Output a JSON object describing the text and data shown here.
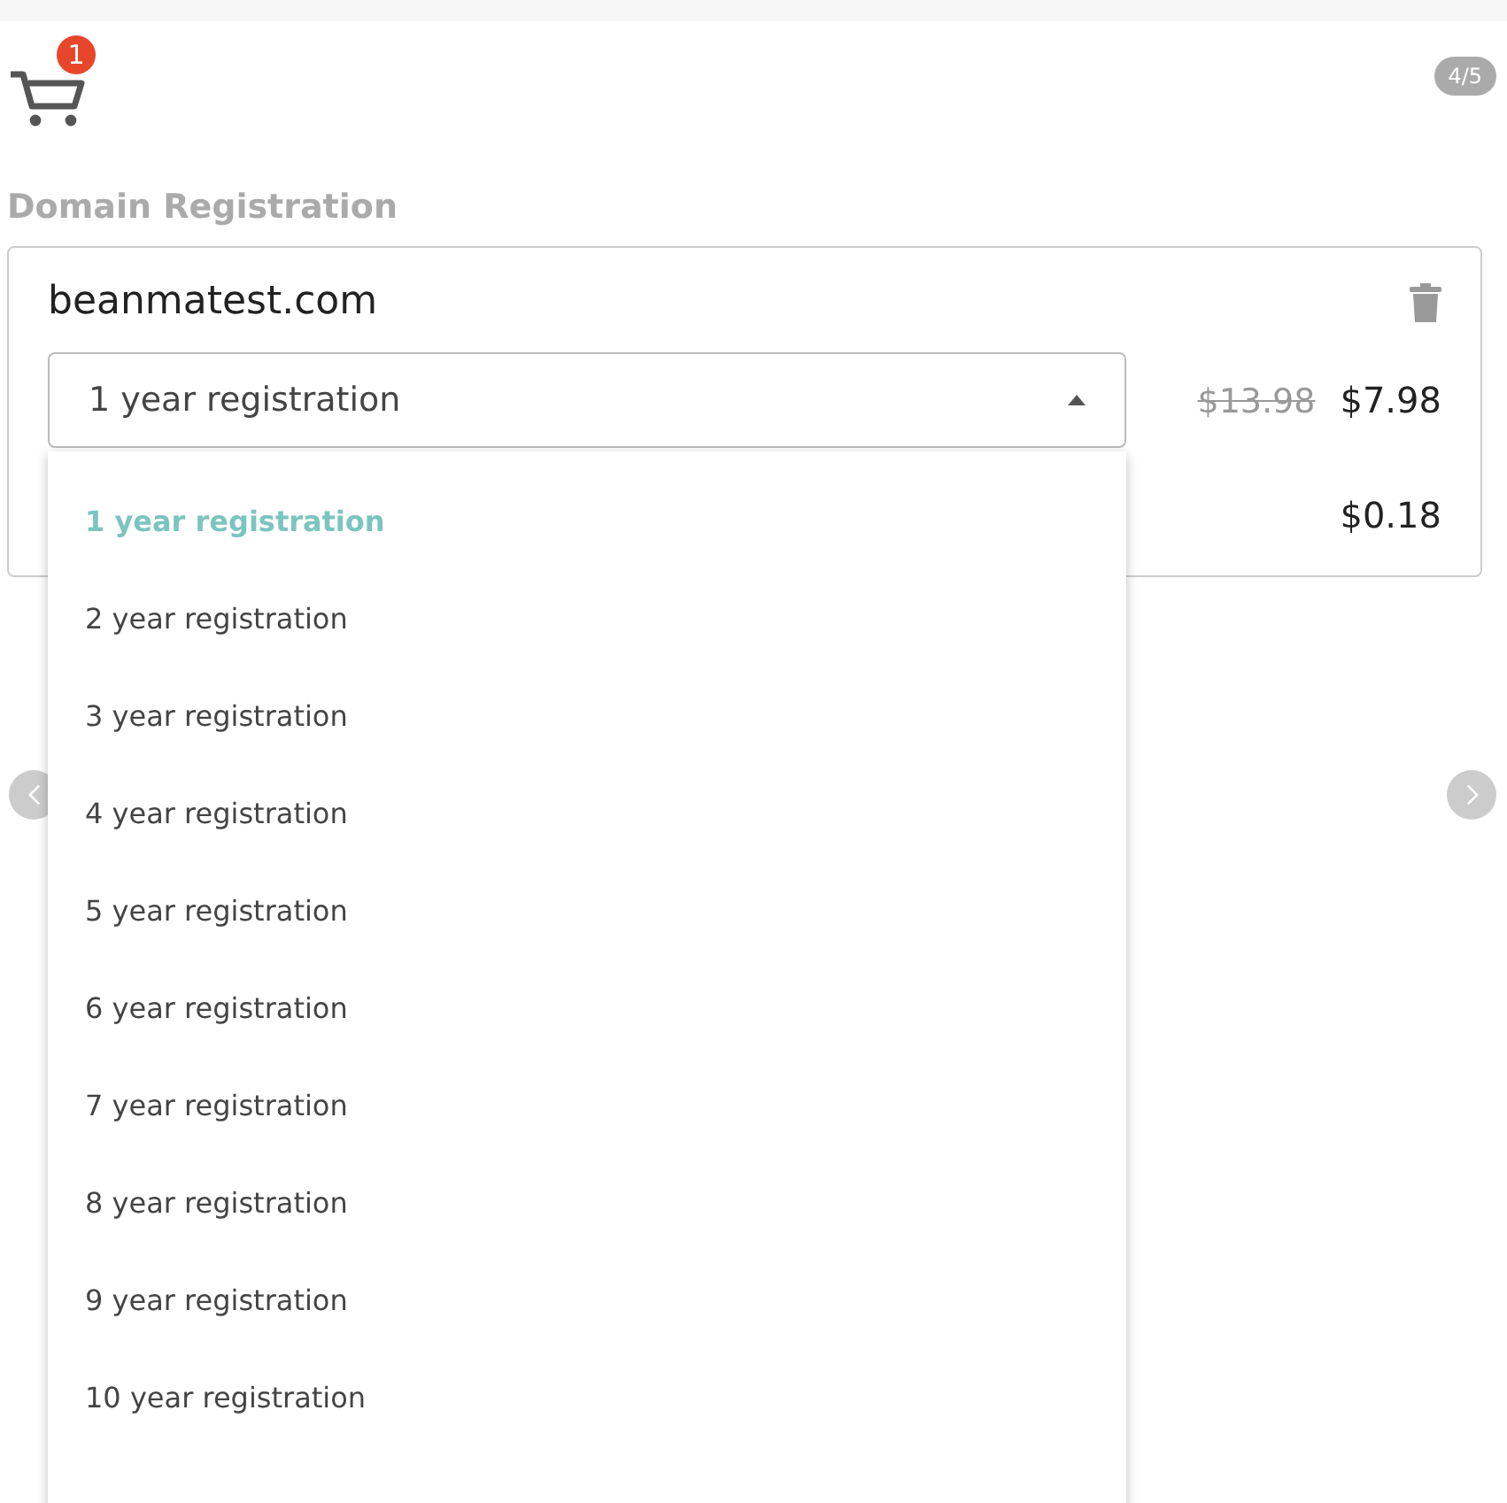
{
  "cart": {
    "count": "1"
  },
  "slide_counter": "4/5",
  "section_title": "Domain Registration",
  "item": {
    "domain": "beanmatest.com",
    "selected_term": "1 year registration",
    "old_price": "$13.98",
    "price": "$7.98",
    "fee": "$0.18"
  },
  "dropdown": {
    "expanded": true,
    "options": [
      {
        "label": "1 year registration",
        "selected": true
      },
      {
        "label": "2 year registration",
        "selected": false
      },
      {
        "label": "3 year registration",
        "selected": false
      },
      {
        "label": "4 year registration",
        "selected": false
      },
      {
        "label": "5 year registration",
        "selected": false
      },
      {
        "label": "6 year registration",
        "selected": false
      },
      {
        "label": "7 year registration",
        "selected": false
      },
      {
        "label": "8 year registration",
        "selected": false
      },
      {
        "label": "9 year registration",
        "selected": false
      },
      {
        "label": "10 year registration",
        "selected": false
      }
    ]
  }
}
